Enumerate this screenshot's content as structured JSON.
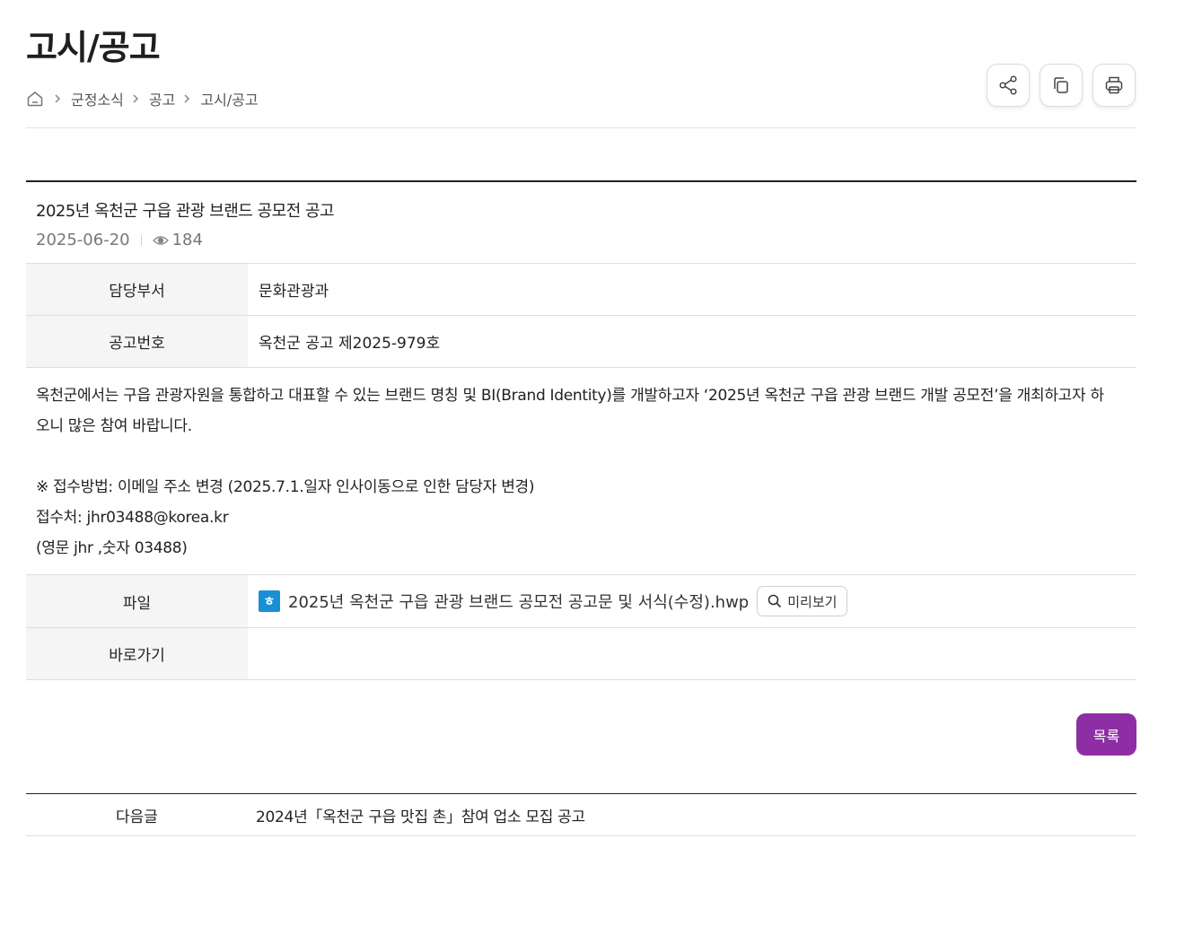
{
  "page": {
    "title": "고시/공고"
  },
  "breadcrumb": {
    "home_icon": "home-icon",
    "items": [
      "군정소식",
      "공고",
      "고시/공고"
    ]
  },
  "toolbar": {
    "share_icon": "share-icon",
    "copy_icon": "copy-icon",
    "print_icon": "print-icon"
  },
  "post": {
    "title": "2025년 옥천군 구읍 관광 브랜드 공모전 공고",
    "date": "2025-06-20",
    "views": "184",
    "fields": {
      "department_label": "담당부서",
      "department_value": "문화관광과",
      "notice_no_label": "공고번호",
      "notice_no_value": "옥천군 공고 제2025-979호",
      "file_label": "파일",
      "shortcut_label": "바로가기"
    },
    "body": {
      "line1": "옥천군에서는 구읍 관광자원을 통합하고 대표할 수 있는 브랜드 명칭 및 BI(Brand Identity)를 개발하고자 ‘2025년 옥천군 구읍 관광 브랜드 개발 공모전’을 개최하고자 하",
      "line2": "오니 많은 참여 바랍니다.",
      "line3": "※ 접수방법: 이메일 주소 변경 (2025.7.1.일자 인사이동으로 인한 담당자 변경)",
      "line4": "접수처: jhr03488@korea.kr",
      "line5": "(영문 jhr ,숫자 03488)"
    },
    "file": {
      "icon_letter": "ㅎ",
      "name": "2025년 옥천군 구읍 관광 브랜드 공모전 공고문 및 서식(수정).hwp",
      "preview_label": "미리보기"
    }
  },
  "actions": {
    "list_label": "목록"
  },
  "navigation": {
    "next_label": "다음글",
    "next_title": "2024년「옥천군 구읍 맛집 촌」참여 업소 모집 공고"
  },
  "colors": {
    "accent": "#8e2ea4",
    "file_icon": "#1a8fd6",
    "header_cell_bg": "#f5f5f5"
  }
}
